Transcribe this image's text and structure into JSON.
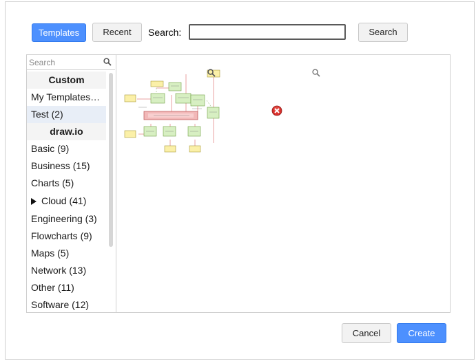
{
  "toolbar": {
    "tab_templates": "Templates",
    "tab_recent": "Recent",
    "search_label": "Search:",
    "search_value": "",
    "search_button": "Search"
  },
  "sidebar": {
    "search_placeholder": "Search",
    "items": [
      {
        "label": "Custom",
        "type": "header"
      },
      {
        "label": "My Templates…",
        "type": "item"
      },
      {
        "label": "Test (2)",
        "type": "item",
        "selected": true
      },
      {
        "label": "draw.io",
        "type": "header"
      },
      {
        "label": "Basic (9)",
        "type": "item"
      },
      {
        "label": "Business (15)",
        "type": "item"
      },
      {
        "label": "Charts (5)",
        "type": "item"
      },
      {
        "label": "Cloud (41)",
        "type": "item",
        "expandable": true
      },
      {
        "label": "Engineering (3)",
        "type": "item"
      },
      {
        "label": "Flowcharts (9)",
        "type": "item"
      },
      {
        "label": "Maps (5)",
        "type": "item"
      },
      {
        "label": "Network (13)",
        "type": "item"
      },
      {
        "label": "Other (11)",
        "type": "item"
      },
      {
        "label": "Software (12)",
        "type": "item"
      }
    ]
  },
  "content": {
    "templates": [
      {
        "icon": "diagram-thumbnail",
        "state": "loaded"
      },
      {
        "icon": "error-icon",
        "state": "failed"
      }
    ]
  },
  "footer": {
    "cancel_label": "Cancel",
    "create_label": "Create"
  },
  "colors": {
    "primary": "#4d90fe",
    "error": "#d9302c",
    "selected_bg": "#e8eef7"
  }
}
